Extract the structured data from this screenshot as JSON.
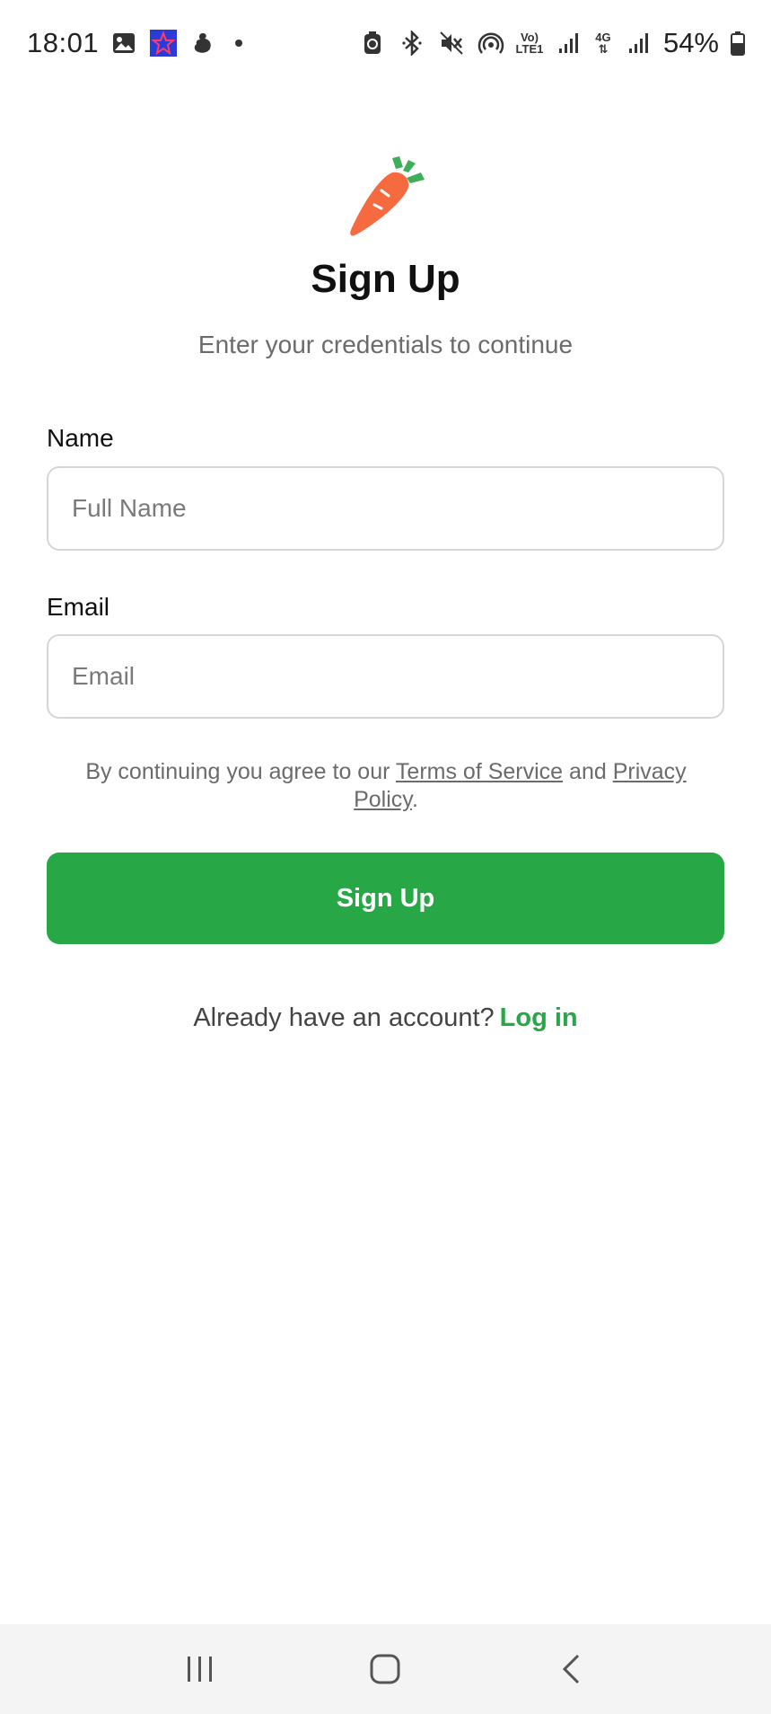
{
  "status_bar": {
    "time": "18:01",
    "battery": "54%",
    "volte_top": "Vo)",
    "volte_bottom": "LTE1",
    "network_type": "4G",
    "icons": [
      "gallery-icon",
      "app-badge-icon",
      "notification-app-icon",
      "dot",
      "battery-saver-icon",
      "bluetooth-icon",
      "mute-icon",
      "hotspot-icon",
      "volte-icon",
      "signal-icon",
      "4g-icon",
      "signal-icon",
      "battery-icon"
    ]
  },
  "header": {
    "logo_icon": "carrot-logo-icon",
    "title": "Sign Up",
    "subtitle": "Enter your credentials to continue"
  },
  "form": {
    "name_label": "Name",
    "name_placeholder": "Full Name",
    "name_value": "",
    "email_label": "Email",
    "email_placeholder": "Email",
    "email_value": ""
  },
  "terms": {
    "prefix": "By continuing you agree to our ",
    "tos_link": "Terms of Service",
    "middle": " and ",
    "privacy_link": "Privacy Policy",
    "suffix": "."
  },
  "actions": {
    "signup_label": "Sign Up"
  },
  "footer": {
    "prompt": "Already have an account?",
    "login_link": "Log in"
  },
  "colors": {
    "accent": "#27a745",
    "carrot": "#f56a3f",
    "leaf": "#3fae5b",
    "text_muted": "#6b6b6b"
  },
  "nav_bar": {
    "icons": [
      "recent-apps-icon",
      "home-icon",
      "back-icon"
    ]
  }
}
